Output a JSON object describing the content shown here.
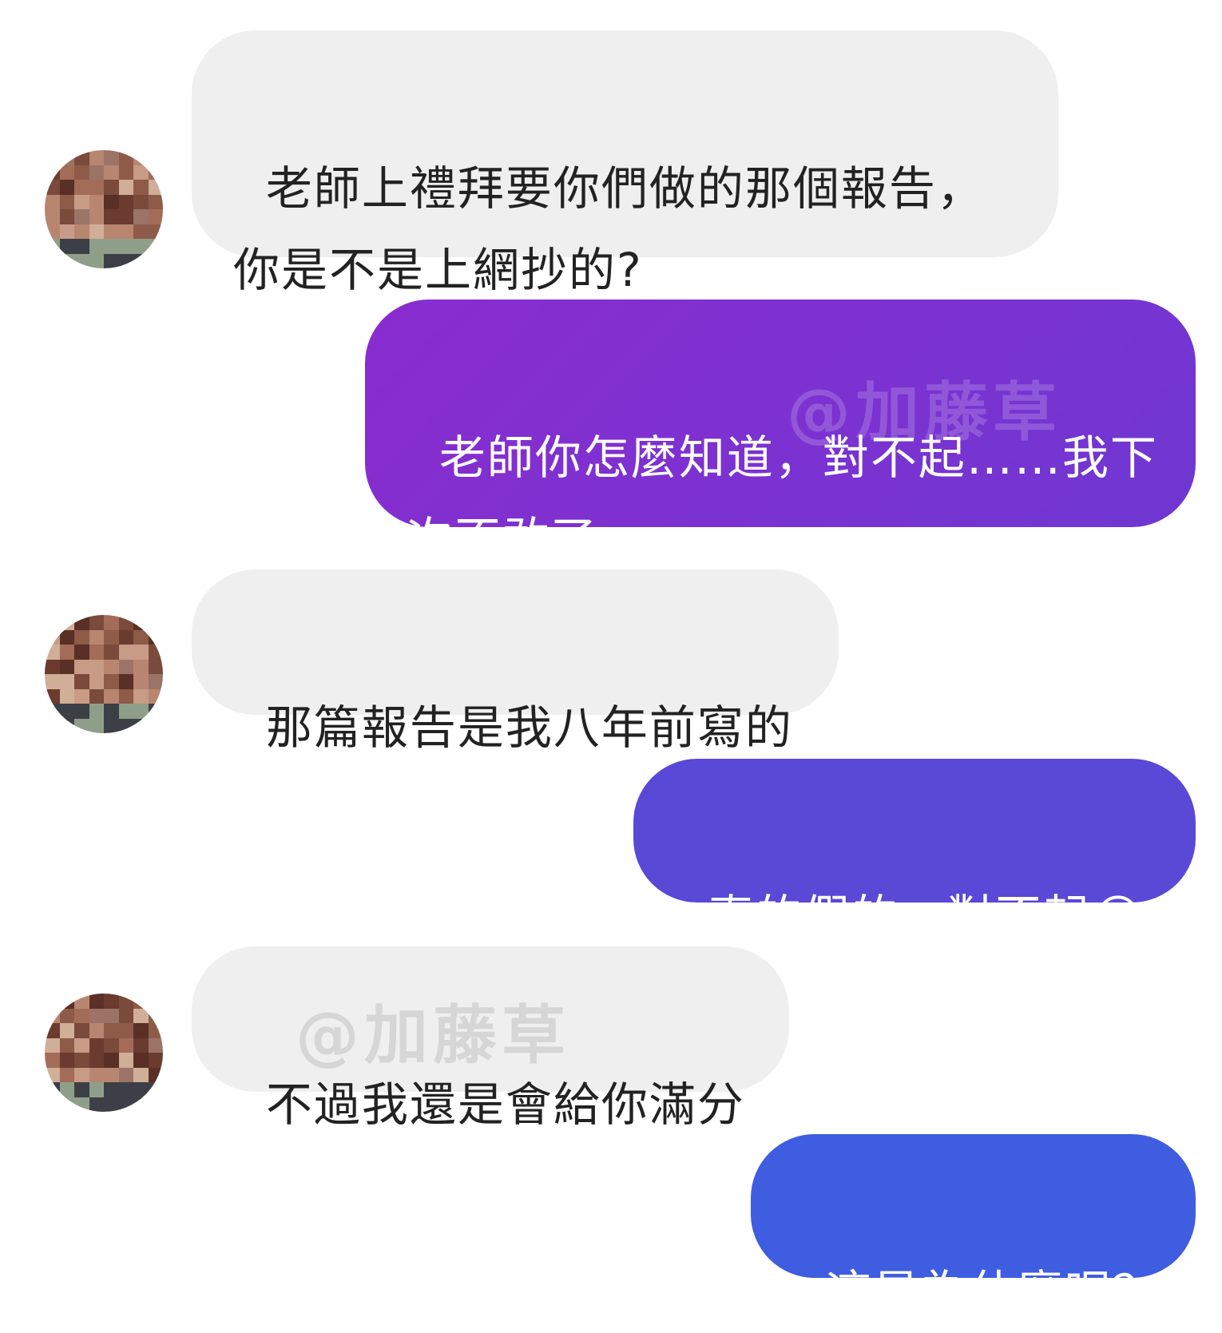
{
  "messages": [
    {
      "side": "incoming",
      "text": "老師上禮拜要你們做的那個報告，\n你是不是上網抄的?"
    },
    {
      "side": "outgoing",
      "text": "老師你怎麼知道，對不起……我下次不敢了……"
    },
    {
      "side": "incoming",
      "text": "那篇報告是我八年前寫的"
    },
    {
      "side": "outgoing",
      "text": "真的假的，對不起😭"
    },
    {
      "side": "incoming",
      "text": "不過我還是會給你滿分"
    },
    {
      "side": "outgoing",
      "text": "這是為什麼呢？"
    }
  ],
  "watermark": "@加藤草",
  "colors": {
    "incoming_bubble": "#efefef",
    "outgoing_1": "#7f2fd0",
    "outgoing_2": "#5a48d6",
    "outgoing_3": "#3f5de0"
  }
}
